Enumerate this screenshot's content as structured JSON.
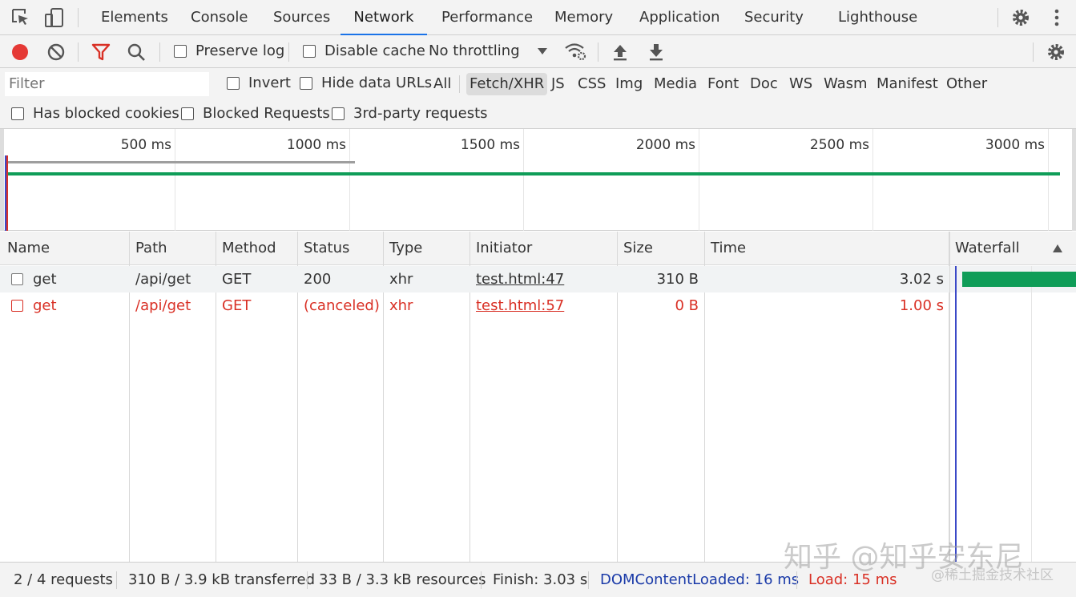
{
  "tabs": {
    "elements": "Elements",
    "console": "Console",
    "sources": "Sources",
    "network": "Network",
    "performance": "Performance",
    "memory": "Memory",
    "application": "Application",
    "security": "Security",
    "lighthouse": "Lighthouse"
  },
  "toolbar": {
    "preserve_log": "Preserve log",
    "disable_cache": "Disable cache",
    "throttling": "No throttling"
  },
  "filter": {
    "placeholder": "Filter",
    "invert": "Invert",
    "hide_data_urls": "Hide data URLs",
    "types": [
      "All",
      "Fetch/XHR",
      "JS",
      "CSS",
      "Img",
      "Media",
      "Font",
      "Doc",
      "WS",
      "Wasm",
      "Manifest",
      "Other"
    ],
    "has_blocked_cookies": "Has blocked cookies",
    "blocked_requests": "Blocked Requests",
    "third_party": "3rd-party requests"
  },
  "overview": {
    "ticks": [
      "500 ms",
      "1000 ms",
      "1500 ms",
      "2000 ms",
      "2500 ms",
      "3000 ms"
    ]
  },
  "table": {
    "headers": {
      "name": "Name",
      "path": "Path",
      "method": "Method",
      "status": "Status",
      "type": "Type",
      "initiator": "Initiator",
      "size": "Size",
      "time": "Time",
      "waterfall": "Waterfall"
    },
    "rows": [
      {
        "name": "get",
        "path": "/api/get",
        "method": "GET",
        "status": "200",
        "type": "xhr",
        "initiator": "test.html:47",
        "size": "310 B",
        "time": "3.02 s"
      },
      {
        "name": "get",
        "path": "/api/get",
        "method": "GET",
        "status": "(canceled)",
        "type": "xhr",
        "initiator": "test.html:57",
        "size": "0 B",
        "time": "1.00 s"
      }
    ]
  },
  "footer": {
    "requests": "2 / 4 requests",
    "transferred": "310 B / 3.9 kB transferred",
    "resources": "33 B / 3.3 kB resources",
    "finish": "Finish: 3.03 s",
    "dom_content_loaded": "DOMContentLoaded: 16 ms",
    "load": "Load: 15 ms"
  },
  "watermark": {
    "main": "知乎 @知乎安东尼",
    "sub": "@稀土掘金技术社区"
  },
  "colors": {
    "record": "#e53935",
    "filter_active": "#d93025",
    "accent": "#1a73e8",
    "waterfall_bar": "#0f9d58",
    "dom_content_loaded": "#1a3aa8",
    "load": "#d93025"
  }
}
